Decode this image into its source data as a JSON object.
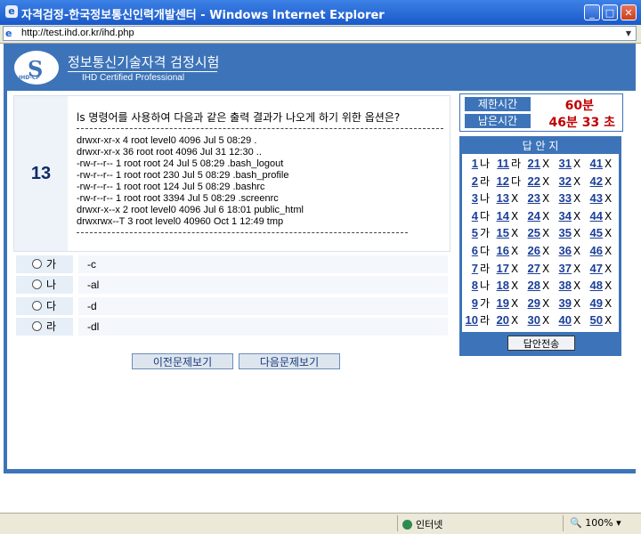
{
  "window": {
    "title": "자격검정-한국정보통신인력개발센터 - Windows Internet Explorer",
    "url": "http://test.ihd.or.kr/ihd.php"
  },
  "header": {
    "title": "정보통신기술자격 검정시험",
    "subtitle": "IHD Certified Professional",
    "logo_letter": "S",
    "logo_text": "IHD-CP"
  },
  "question": {
    "number": "13",
    "text": "ls 명령어를 사용하여 다음과 같은 출력 결과가 나오게 하기 위한 옵션은?",
    "lines": [
      "drwxr-xr-x 4 root level0 4096 Jul 5 08:29 .",
      "drwxr-xr-x 36 root root 4096 Jul 31 12:30 ..",
      "-rw-r--r-- 1 root root 24 Jul 5 08:29 .bash_logout",
      "-rw-r--r-- 1 root root 230 Jul 5 08:29 .bash_profile",
      "-rw-r--r-- 1 root root 124 Jul 5 08:29 .bashrc",
      "-rw-r--r-- 1 root root 3394 Jul 5 08:29 .screenrc",
      "drwxr-x--x 2 root level0 4096 Jul 6 18:01 public_html",
      "drwxrwx--T 3 root level0 40960 Oct 1 12:49 tmp"
    ]
  },
  "options": [
    {
      "label": "가",
      "text": "-c"
    },
    {
      "label": "나",
      "text": "-al"
    },
    {
      "label": "다",
      "text": "-d"
    },
    {
      "label": "라",
      "text": "-dl"
    }
  ],
  "buttons": {
    "prev": "이전문제보기",
    "next": "다음문제보기",
    "submit": "답안전송"
  },
  "timer": {
    "limit_label": "제한시간",
    "limit_value": "60분",
    "remain_label": "남은시간",
    "remain_value": "46분 33 초"
  },
  "answer_sheet": {
    "title": "답 안 지",
    "columns": [
      [
        {
          "n": "1",
          "a": "나"
        },
        {
          "n": "2",
          "a": "라"
        },
        {
          "n": "3",
          "a": "나"
        },
        {
          "n": "4",
          "a": "다"
        },
        {
          "n": "5",
          "a": "가"
        },
        {
          "n": "6",
          "a": "다"
        },
        {
          "n": "7",
          "a": "라"
        },
        {
          "n": "8",
          "a": "나"
        },
        {
          "n": "9",
          "a": "가"
        },
        {
          "n": "10",
          "a": "라"
        }
      ],
      [
        {
          "n": "11",
          "a": "라"
        },
        {
          "n": "12",
          "a": "다"
        },
        {
          "n": "13",
          "a": "X"
        },
        {
          "n": "14",
          "a": "X"
        },
        {
          "n": "15",
          "a": "X"
        },
        {
          "n": "16",
          "a": "X"
        },
        {
          "n": "17",
          "a": "X"
        },
        {
          "n": "18",
          "a": "X"
        },
        {
          "n": "19",
          "a": "X"
        },
        {
          "n": "20",
          "a": "X"
        }
      ],
      [
        {
          "n": "21",
          "a": "X"
        },
        {
          "n": "22",
          "a": "X"
        },
        {
          "n": "23",
          "a": "X"
        },
        {
          "n": "24",
          "a": "X"
        },
        {
          "n": "25",
          "a": "X"
        },
        {
          "n": "26",
          "a": "X"
        },
        {
          "n": "27",
          "a": "X"
        },
        {
          "n": "28",
          "a": "X"
        },
        {
          "n": "29",
          "a": "X"
        },
        {
          "n": "30",
          "a": "X"
        }
      ],
      [
        {
          "n": "31",
          "a": "X"
        },
        {
          "n": "32",
          "a": "X"
        },
        {
          "n": "33",
          "a": "X"
        },
        {
          "n": "34",
          "a": "X"
        },
        {
          "n": "35",
          "a": "X"
        },
        {
          "n": "36",
          "a": "X"
        },
        {
          "n": "37",
          "a": "X"
        },
        {
          "n": "38",
          "a": "X"
        },
        {
          "n": "39",
          "a": "X"
        },
        {
          "n": "40",
          "a": "X"
        }
      ],
      [
        {
          "n": "41",
          "a": "X"
        },
        {
          "n": "42",
          "a": "X"
        },
        {
          "n": "43",
          "a": "X"
        },
        {
          "n": "44",
          "a": "X"
        },
        {
          "n": "45",
          "a": "X"
        },
        {
          "n": "46",
          "a": "X"
        },
        {
          "n": "47",
          "a": "X"
        },
        {
          "n": "48",
          "a": "X"
        },
        {
          "n": "49",
          "a": "X"
        },
        {
          "n": "50",
          "a": "X"
        }
      ]
    ]
  },
  "status": {
    "zone": "인터넷",
    "zoom": "100%"
  },
  "colors": {
    "primary": "#3d74b9",
    "timer_value": "#c00000",
    "question_number": "#0d2c66"
  }
}
